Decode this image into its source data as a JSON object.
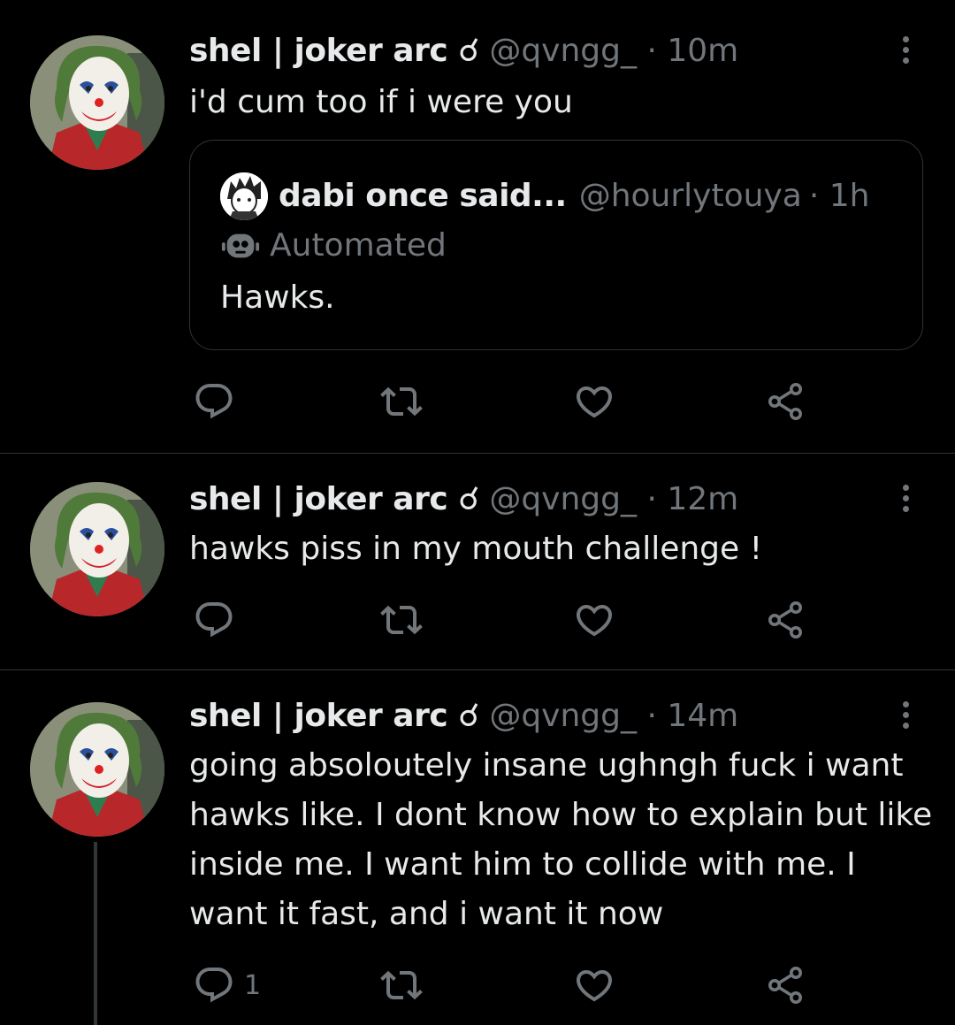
{
  "tweets": [
    {
      "name": "shel | joker arc ☌",
      "handle": "@qvngg_",
      "time": "· 10m",
      "text": "i'd cum too if i were you",
      "quote": {
        "name": "dabi once said...",
        "handle": "@hourlytouya",
        "time": "· 1h",
        "automated_label": "Automated",
        "text": "Hawks."
      },
      "reply_count": "",
      "icons": [
        "reply-icon",
        "retweet-icon",
        "like-icon",
        "share-icon"
      ]
    },
    {
      "name": "shel | joker arc ☌",
      "handle": "@qvngg_",
      "time": "· 12m",
      "text": "hawks piss in my mouth challenge !",
      "reply_count": "",
      "icons": [
        "reply-icon",
        "retweet-icon",
        "like-icon",
        "share-icon"
      ]
    },
    {
      "name": "shel | joker arc ☌",
      "handle": "@qvngg_",
      "time": "· 14m",
      "text": "going absoloutely insane ughngh fuck i want hawks like. I dont know how to explain but like inside me. I want him to collide with me. I want it fast, and i want it now",
      "reply_count": "1",
      "icons": [
        "reply-icon",
        "retweet-icon",
        "like-icon",
        "share-icon"
      ]
    }
  ],
  "colors": {
    "background": "#000000",
    "text": "#e7e9ea",
    "secondary": "#71767b",
    "border": "#2f3336"
  }
}
